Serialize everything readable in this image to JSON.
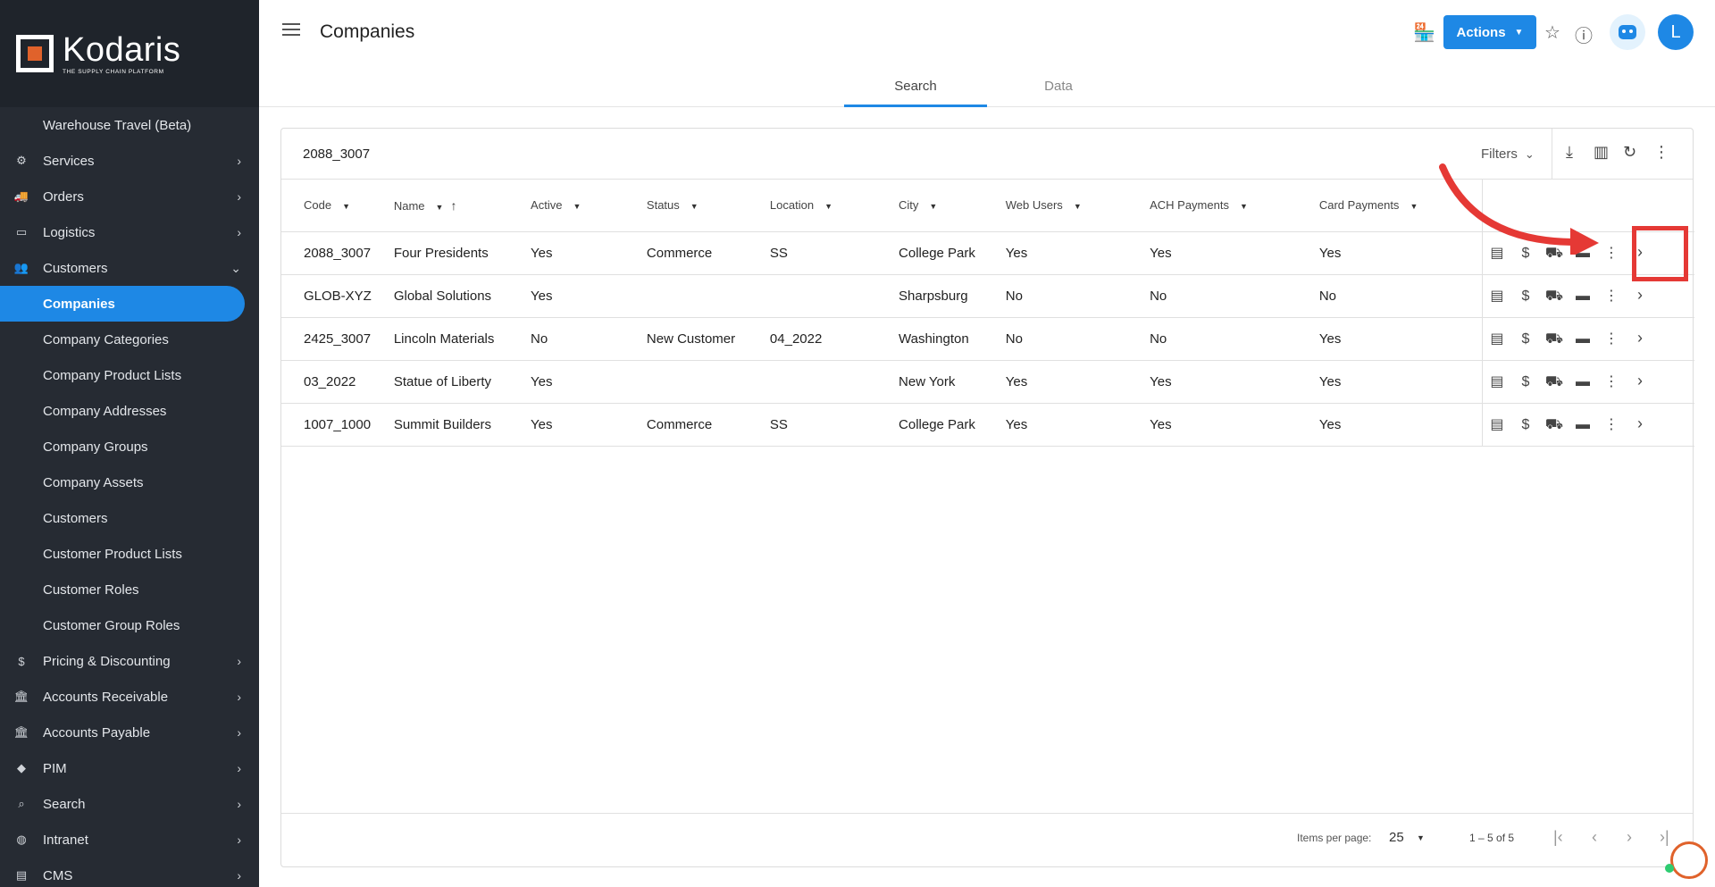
{
  "app": {
    "logo_name": "Kodaris",
    "logo_tagline": "THE SUPPLY CHAIN PLATFORM",
    "brand_color": "#e0622b",
    "accent_color": "#1e88e5"
  },
  "sidebar": {
    "top_item": "Warehouse Travel (Beta)",
    "items": [
      {
        "label": "Services",
        "icon": "gears-icon"
      },
      {
        "label": "Orders",
        "icon": "truck-icon"
      },
      {
        "label": "Logistics",
        "icon": "shipping-icon"
      },
      {
        "label": "Customers",
        "icon": "people-icon",
        "expanded": true
      }
    ],
    "sub_items": [
      "Companies",
      "Company Categories",
      "Company Product Lists",
      "Company Addresses",
      "Company Groups",
      "Company Assets",
      "Customers",
      "Customer Product Lists",
      "Customer Roles",
      "Customer Group Roles"
    ],
    "active_sub_item": "Companies",
    "bottom_items": [
      {
        "label": "Pricing & Discounting",
        "icon": "dollar-icon"
      },
      {
        "label": "Accounts Receivable",
        "icon": "bank-icon"
      },
      {
        "label": "Accounts Payable",
        "icon": "bank-icon"
      },
      {
        "label": "PIM",
        "icon": "tag-icon"
      },
      {
        "label": "Search",
        "icon": "search-icon"
      },
      {
        "label": "Intranet",
        "icon": "globe-icon"
      },
      {
        "label": "CMS",
        "icon": "browser-icon"
      }
    ]
  },
  "header": {
    "title": "Companies",
    "actions_label": "Actions",
    "avatar_initial": "L",
    "tabs": [
      {
        "label": "Search",
        "active": true
      },
      {
        "label": "Data",
        "active": false
      }
    ]
  },
  "search": {
    "value": "2088_3007",
    "filters_label": "Filters"
  },
  "table": {
    "columns": [
      "Code",
      "Name",
      "Active",
      "Status",
      "Location",
      "City",
      "Web Users",
      "ACH Payments",
      "Card Payments"
    ],
    "sorted_column": "Name",
    "rows": [
      {
        "code": "2088_3007",
        "name": "Four Presidents",
        "active": "Yes",
        "status": "Commerce",
        "location": "SS",
        "city": "College Park",
        "web_users": "Yes",
        "ach": "Yes",
        "card": "Yes"
      },
      {
        "code": "GLOB-XYZ",
        "name": "Global Solutions",
        "active": "Yes",
        "status": "",
        "location": "",
        "city": "Sharpsburg",
        "web_users": "No",
        "ach": "No",
        "card": "No"
      },
      {
        "code": "2425_3007",
        "name": "Lincoln Materials",
        "active": "No",
        "status": "New Customer",
        "location": "04_2022",
        "city": "Washington",
        "web_users": "No",
        "ach": "No",
        "card": "Yes"
      },
      {
        "code": "03_2022",
        "name": "Statue of Liberty",
        "active": "Yes",
        "status": "",
        "location": "",
        "city": "New York",
        "web_users": "Yes",
        "ach": "Yes",
        "card": "Yes"
      },
      {
        "code": "1007_1000",
        "name": "Summit Builders",
        "active": "Yes",
        "status": "Commerce",
        "location": "SS",
        "city": "College Park",
        "web_users": "Yes",
        "ach": "Yes",
        "card": "Yes"
      }
    ]
  },
  "paginator": {
    "items_per_page_label": "Items per page:",
    "items_per_page": "25",
    "range": "1 – 5 of 5"
  }
}
